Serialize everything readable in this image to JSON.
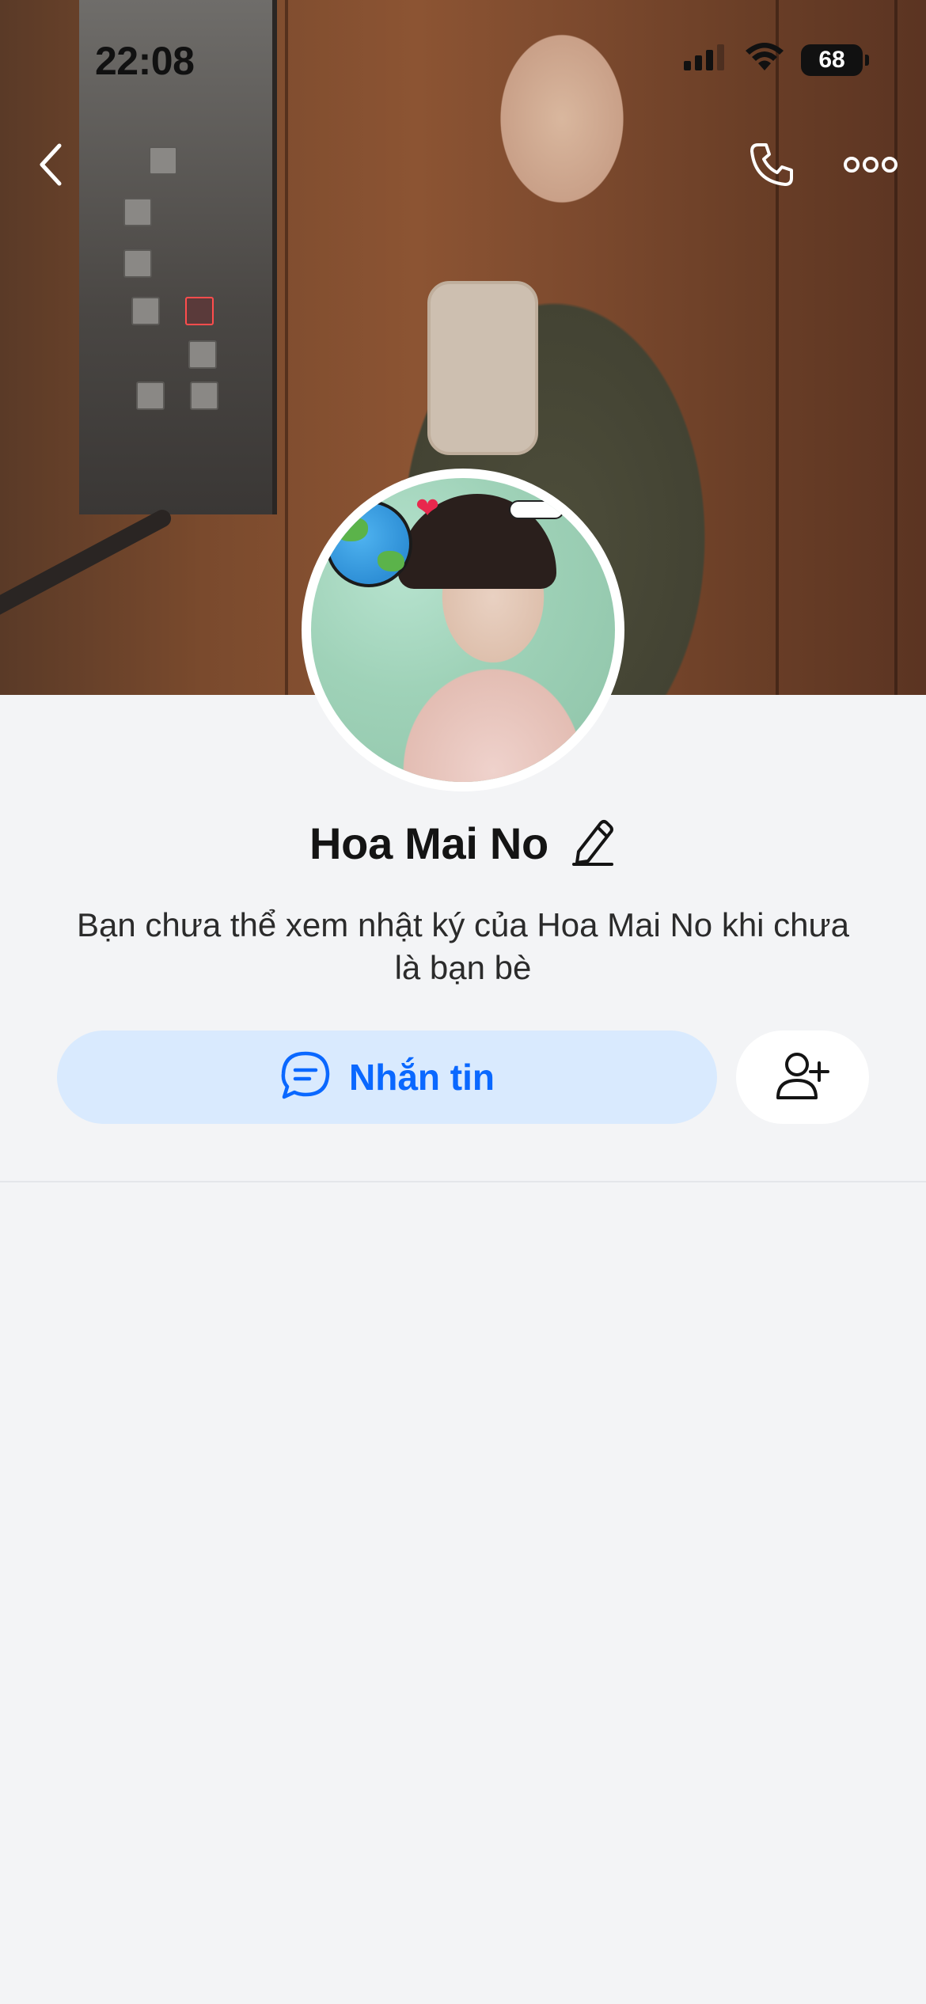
{
  "status_bar": {
    "time": "22:08",
    "battery_level": "68",
    "icons": [
      "cellular-signal-icon",
      "wifi-icon",
      "battery-icon"
    ]
  },
  "top_nav": {
    "icons": [
      "back-arrow-icon",
      "phone-call-icon",
      "more-options-icon"
    ]
  },
  "profile": {
    "name": "Hoa Mai No",
    "privacy_note": "Bạn chưa thể xem nhật ký của Hoa Mai No khi chưa là bạn bè"
  },
  "actions": {
    "message_label": "Nhắn tin",
    "message_icon": "chat-bubble-icon",
    "add_friend_icon": "add-friend-icon"
  },
  "colors": {
    "accent": "#0a68ff",
    "message_button_bg": "#d9eafe",
    "page_bg": "#f3f4f6"
  }
}
